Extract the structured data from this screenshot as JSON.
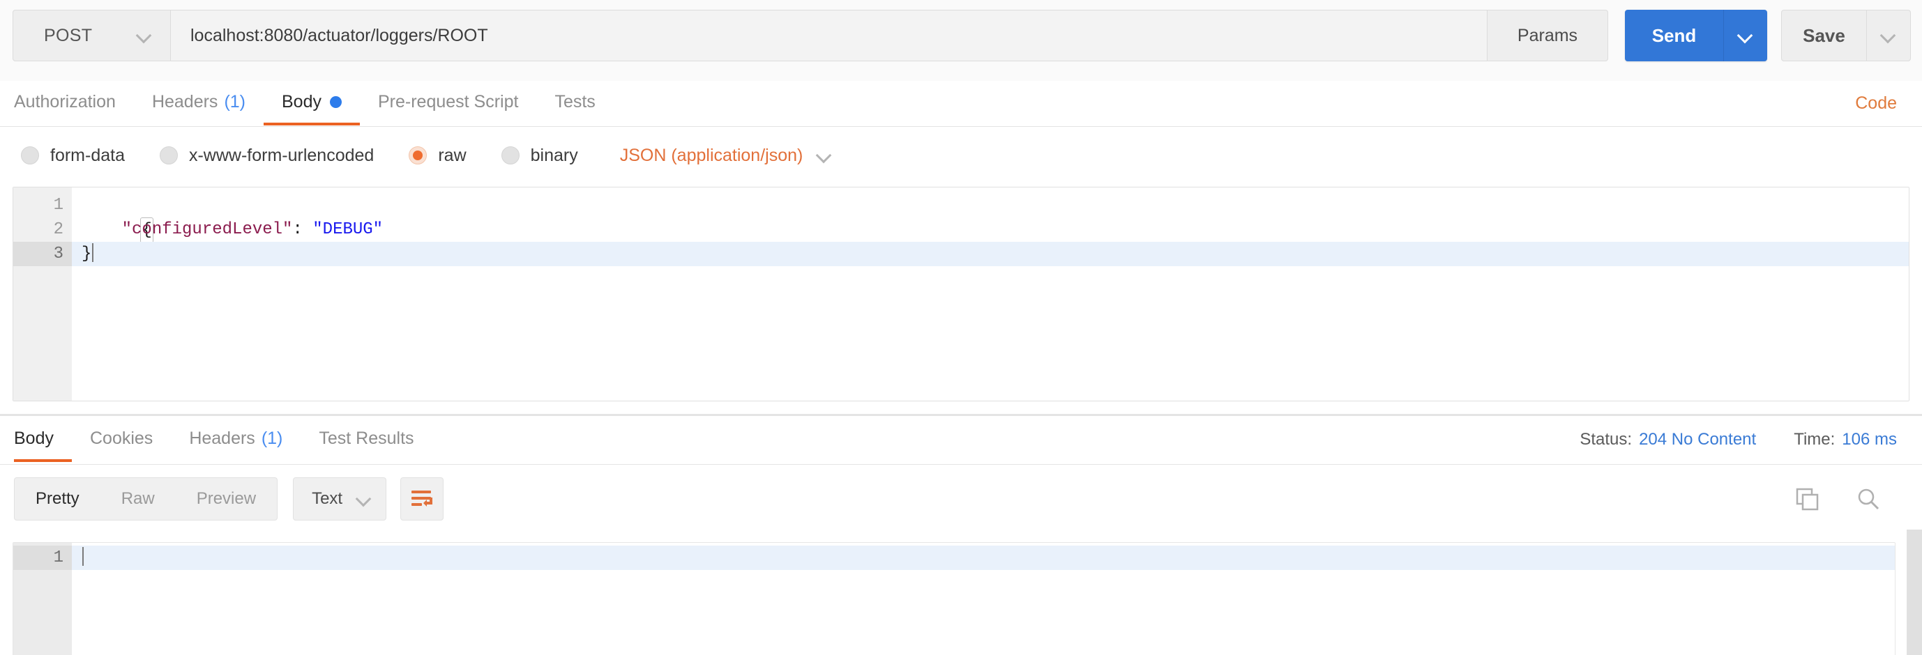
{
  "request": {
    "method": "POST",
    "url": "localhost:8080/actuator/loggers/ROOT",
    "params_label": "Params",
    "send_label": "Send",
    "save_label": "Save",
    "tabs": [
      {
        "label": "Authorization",
        "count": "",
        "active": false,
        "dot": false
      },
      {
        "label": "Headers",
        "count": "(1)",
        "active": false,
        "dot": false
      },
      {
        "label": "Body",
        "count": "",
        "active": true,
        "dot": true
      },
      {
        "label": "Pre-request Script",
        "count": "",
        "active": false,
        "dot": false
      },
      {
        "label": "Tests",
        "count": "",
        "active": false,
        "dot": false
      }
    ],
    "code_link": "Code",
    "body_modes": [
      {
        "label": "form-data",
        "selected": false
      },
      {
        "label": "x-www-form-urlencoded",
        "selected": false
      },
      {
        "label": "raw",
        "selected": true
      },
      {
        "label": "binary",
        "selected": false
      }
    ],
    "content_type": "JSON (application/json)",
    "editor": {
      "lines": [
        {
          "number": "1",
          "foldable": true,
          "active": false
        },
        {
          "number": "2",
          "foldable": false,
          "active": false
        },
        {
          "number": "3",
          "foldable": false,
          "active": true
        }
      ],
      "line1_open_brace": "{",
      "line2_key": "\"configuredLevel\"",
      "line2_colon": ": ",
      "line2_value": "\"DEBUG\"",
      "line2_indent": "    ",
      "line3_close_brace": "}"
    }
  },
  "response": {
    "tabs": [
      {
        "label": "Body",
        "count": "",
        "active": true
      },
      {
        "label": "Cookies",
        "count": "",
        "active": false
      },
      {
        "label": "Headers",
        "count": "(1)",
        "active": false
      },
      {
        "label": "Test Results",
        "count": "",
        "active": false
      }
    ],
    "status_label": "Status:",
    "status_value": "204 No Content",
    "time_label": "Time:",
    "time_value": "106 ms",
    "view_modes": [
      {
        "label": "Pretty",
        "active": true
      },
      {
        "label": "Raw",
        "active": false
      },
      {
        "label": "Preview",
        "active": false
      }
    ],
    "format": "Text",
    "editor": {
      "lines": [
        {
          "number": "1",
          "active": true
        }
      ],
      "content": ""
    }
  },
  "colors": {
    "accent_orange": "#eb6223",
    "send_blue": "#3277d7",
    "link_blue": "#3a7bd5",
    "key_maroon": "#8b1c4e",
    "string_blue": "#1a1aee"
  }
}
